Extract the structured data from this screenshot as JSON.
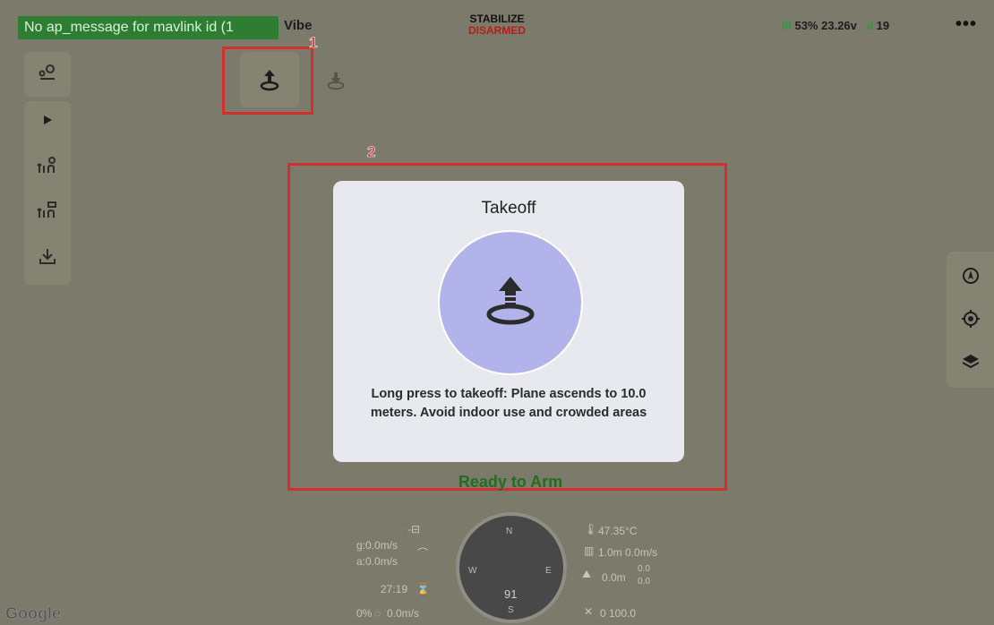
{
  "topbar": {
    "message": "No ap_message for mavlink id (1",
    "vehicle": "Vibe",
    "mode": "STABILIZE",
    "arm_state": "DISARMED",
    "battery_percent": "53%",
    "voltage": "23.26v",
    "satellites": "19",
    "more_icon": "•••"
  },
  "left_toolbar": {
    "icons": [
      "route-pin-icon",
      "play-icon",
      "waypoint-upload-icon",
      "waypoint-download-icon",
      "download-icon"
    ]
  },
  "actions": {
    "takeoff_icon": "takeoff-icon",
    "land_icon": "land-icon"
  },
  "annotations": {
    "label1": "1",
    "label2": "2",
    "color": "#d32f2f"
  },
  "dialog": {
    "title": "Takeoff",
    "description": "Long press to takeoff: Plane ascends to 10.0 meters. Avoid indoor use and crowded areas"
  },
  "ready_text": "Ready to Arm",
  "right_toolbar": {
    "icons": [
      "navigate-icon",
      "locate-icon",
      "layers-icon"
    ]
  },
  "telemetry": {
    "ground_speed": "g:0.0m/s",
    "air_speed": "a:0.0m/s",
    "time": "27:19",
    "throttle": "0%",
    "climb": "0.0m/s",
    "temperature": "47.35°C",
    "alt_rate": "1.0m 0.0m/s",
    "altitude": "0.0m",
    "alt_sub1": "0.0",
    "alt_sub2": "0.0",
    "distance": "0 100.0",
    "heading": "91",
    "compass_n": "N",
    "compass_s": "S",
    "compass_e": "E",
    "compass_w": "W"
  },
  "map": {
    "attribution": "Google"
  },
  "colors": {
    "accent_green": "#2e7d32",
    "disarmed_red": "#b71c1c",
    "dialog_circle": "#b3b3ec"
  }
}
